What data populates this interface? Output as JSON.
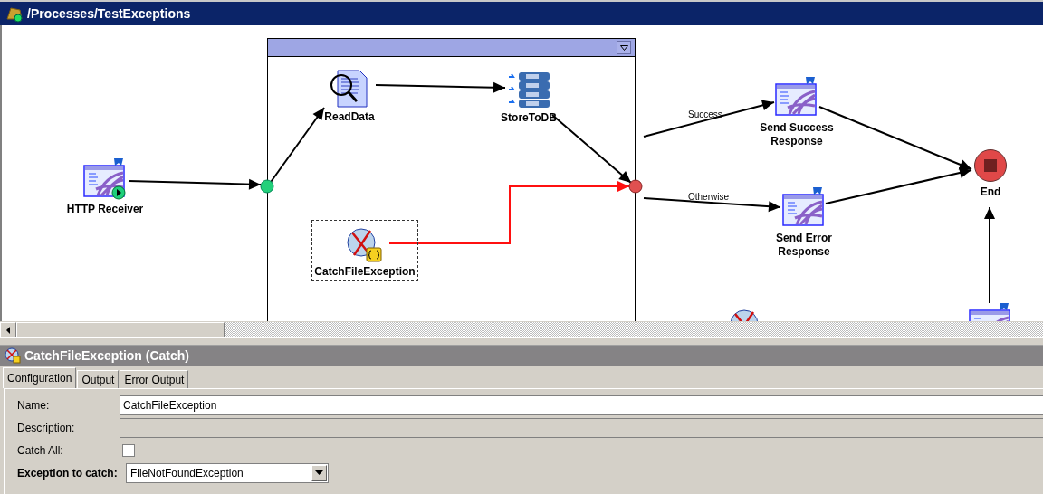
{
  "window": {
    "title": "/Processes/TestExceptions"
  },
  "diagram": {
    "group": {
      "collapsible": true
    },
    "nodes": [
      {
        "kind": "receiver",
        "label": "HTTP Receiver",
        "selected": false
      },
      {
        "kind": "reader",
        "label": "ReadData",
        "selected": false
      },
      {
        "kind": "database",
        "label": "StoreToDB",
        "selected": false
      },
      {
        "kind": "catch",
        "label": "CatchFileException",
        "selected": true
      },
      {
        "kind": "sender",
        "label": "Send Success Response",
        "selected": false
      },
      {
        "kind": "sender",
        "label": "Send Error Response",
        "selected": false
      },
      {
        "kind": "end",
        "label": "End",
        "selected": false
      },
      {
        "kind": "catch",
        "selected": false
      },
      {
        "kind": "sender",
        "selected": false
      }
    ],
    "transitions": [
      {
        "kind": "normal"
      },
      {
        "kind": "normal"
      },
      {
        "kind": "normal"
      },
      {
        "kind": "normal"
      },
      {
        "kind": "error"
      },
      {
        "kind": "normal",
        "label": "Success"
      },
      {
        "kind": "normal",
        "label": "Otherwise"
      },
      {
        "kind": "normal"
      },
      {
        "kind": "normal"
      },
      {
        "kind": "normal"
      }
    ]
  },
  "panel": {
    "title": "CatchFileException (Catch)",
    "tabs": [
      {
        "label": "Configuration",
        "selected": true
      },
      {
        "label": "Output",
        "selected": false
      },
      {
        "label": "Error Output",
        "selected": false
      }
    ],
    "fields": [
      {
        "kind": "text",
        "label": "Name:",
        "value": "CatchFileException",
        "disabled": false
      },
      {
        "kind": "text",
        "label": "Description:",
        "disabled": true
      },
      {
        "kind": "checkbox",
        "label": "Catch All:",
        "checked": false
      },
      {
        "kind": "select",
        "label": "Exception to catch:",
        "value": "FileNotFoundException",
        "required": true
      }
    ]
  }
}
